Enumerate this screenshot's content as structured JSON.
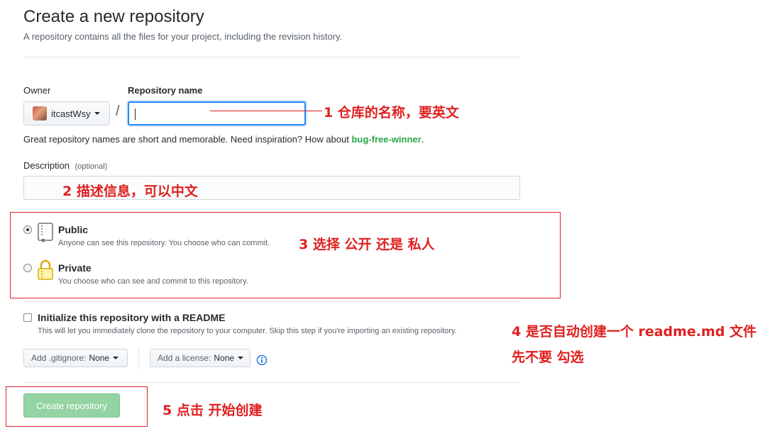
{
  "header": {
    "title": "Create a new repository",
    "subtitle": "A repository contains all the files for your project, including the revision history."
  },
  "owner": {
    "label": "Owner",
    "value": "itcastWsy"
  },
  "repo_name": {
    "label": "Repository name",
    "value": "",
    "separator": "/"
  },
  "hint": {
    "prefix": "Great repository names are short and memorable. Need inspiration? How about ",
    "suggestion": "bug-free-winner",
    "suffix": "."
  },
  "description": {
    "label": "Description",
    "optional": "(optional)",
    "value": ""
  },
  "visibility": {
    "public": {
      "title": "Public",
      "desc": "Anyone can see this repository. You choose who can commit.",
      "selected": true
    },
    "private": {
      "title": "Private",
      "desc": "You choose who can see and commit to this repository.",
      "selected": false
    }
  },
  "readme": {
    "label": "Initialize this repository with a README",
    "desc": "This will let you immediately clone the repository to your computer. Skip this step if you're importing an existing repository.",
    "checked": false
  },
  "gitignore": {
    "prefix": "Add .gitignore:",
    "value": "None"
  },
  "license": {
    "prefix": "Add a license:",
    "value": "None"
  },
  "submit": {
    "label": "Create repository"
  },
  "annotations": {
    "a1": "1 仓库的名称，要英文",
    "a2": "2 描述信息，可以中文",
    "a3": "3 选择 公开 还是 私人",
    "a4_line1": "4 是否自动创建一个  readme.md 文件",
    "a4_line2": "先不要 勾选",
    "a5": "5 点击 开始创建"
  },
  "colors": {
    "annotation": "#e02020",
    "link_green": "#28a745",
    "focus": "#2188ff",
    "create_button": "#94d3a2"
  }
}
